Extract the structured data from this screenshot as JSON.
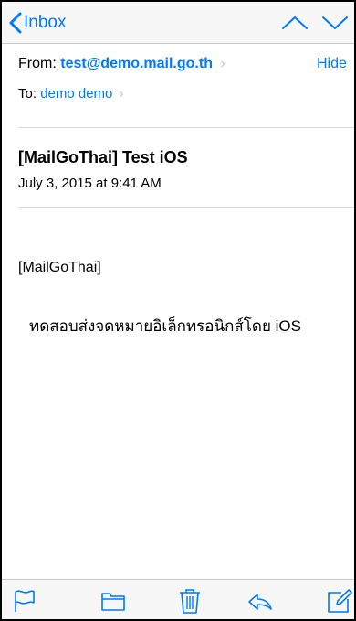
{
  "navbar": {
    "back_label": "Inbox"
  },
  "header": {
    "from_label": "From:",
    "from_address": "test@demo.mail.go.th",
    "hide_label": "Hide",
    "to_label": "To:",
    "to_name": "demo demo"
  },
  "message": {
    "subject": "[MailGoThai] Test iOS",
    "date": "July 3, 2015 at 9:41 AM",
    "body_tag": "[MailGoThai]",
    "body_text": "ทดสอบส่งจดหมายอิเล็กทรอนิกส์โดย iOS"
  },
  "toolbar": {
    "icons": [
      "flag-icon",
      "folder-icon",
      "trash-icon",
      "reply-icon",
      "compose-icon"
    ]
  },
  "colors": {
    "accent": "#007aff",
    "bar_background": "#f7f7f7",
    "separator": "#d9d9d9"
  }
}
